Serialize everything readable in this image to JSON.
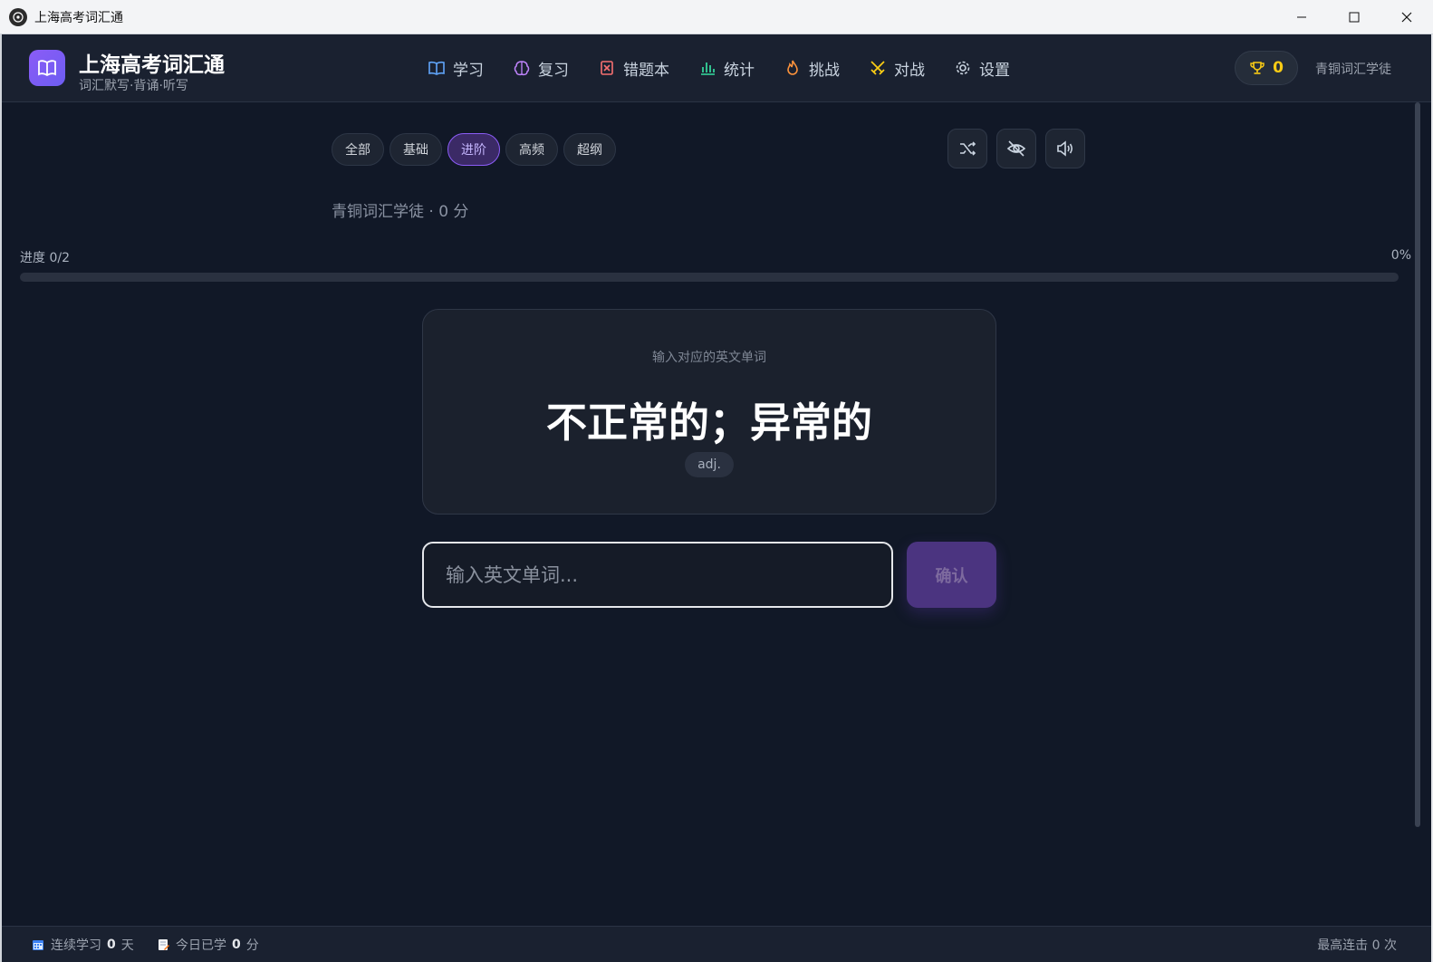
{
  "window": {
    "title": "上海高考词汇通"
  },
  "header": {
    "brand_title": "上海高考词汇通",
    "brand_subtitle": "词汇默写·背诵·听写",
    "nav": [
      {
        "label": "学习",
        "icon": "book-open-icon",
        "color": "#60a5fa"
      },
      {
        "label": "复习",
        "icon": "brain-icon",
        "color": "#c084fc"
      },
      {
        "label": "错题本",
        "icon": "x-square-icon",
        "color": "#f87171"
      },
      {
        "label": "统计",
        "icon": "bar-chart-icon",
        "color": "#34d399"
      },
      {
        "label": "挑战",
        "icon": "flame-icon",
        "color": "#fb923c"
      },
      {
        "label": "对战",
        "icon": "swords-icon",
        "color": "#facc15"
      },
      {
        "label": "设置",
        "icon": "gear-icon",
        "color": "#cbd5e1"
      }
    ],
    "score": "0",
    "rank": "青铜词汇学徒"
  },
  "filters": [
    {
      "label": "全部",
      "active": false
    },
    {
      "label": "基础",
      "active": false
    },
    {
      "label": "进阶",
      "active": true
    },
    {
      "label": "高频",
      "active": false
    },
    {
      "label": "超纲",
      "active": false
    }
  ],
  "tools": [
    "shuffle-icon",
    "eye-off-icon",
    "volume-icon"
  ],
  "rank_line": "青铜词汇学徒 · 0 分",
  "progress": {
    "label": "进度 0/2",
    "percent_text": "0%",
    "fraction": 0
  },
  "card": {
    "hint": "输入对应的英文单词",
    "word": "不正常的；异常的",
    "pos": "adj."
  },
  "answer": {
    "placeholder": "输入英文单词...",
    "value": "",
    "confirm_label": "确认"
  },
  "statusbar": {
    "streak_prefix": "连续学习",
    "streak_value": "0",
    "streak_unit": "天",
    "today_prefix": "今日已学",
    "today_value": "0",
    "today_unit": "分",
    "best_combo": "最高连击 0 次"
  },
  "colors": {
    "accent": "#8b5cf6",
    "background": "#111827",
    "gold": "#facc15"
  }
}
